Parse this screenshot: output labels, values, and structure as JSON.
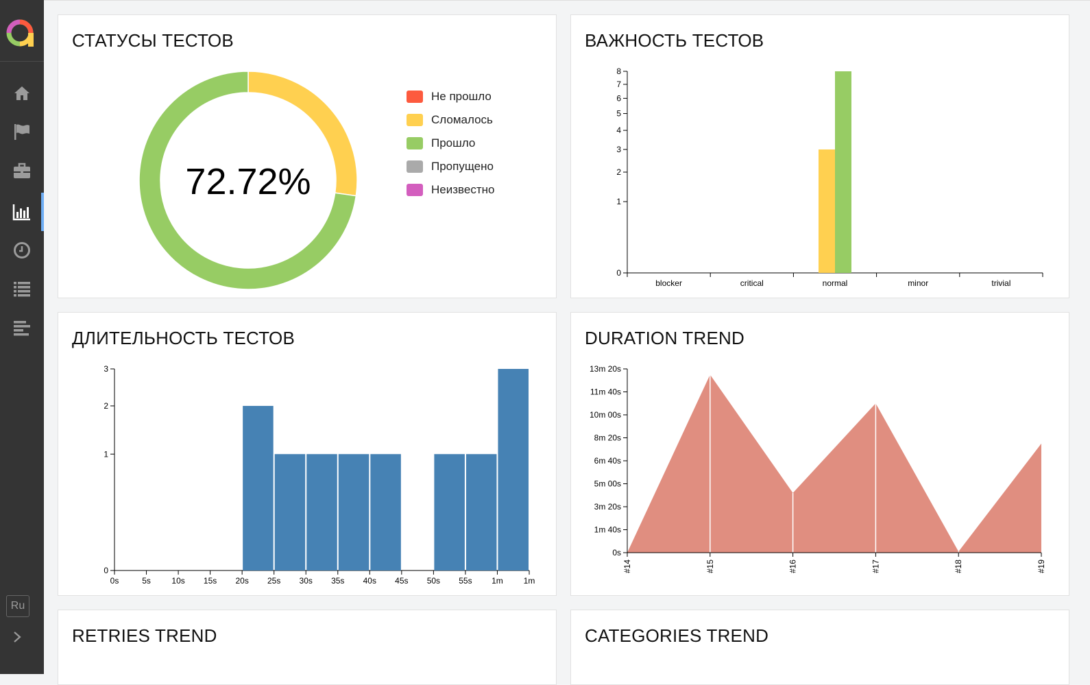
{
  "nav": {
    "items": [
      {
        "icon": "home-icon"
      },
      {
        "icon": "flag-icon"
      },
      {
        "icon": "briefcase-icon"
      },
      {
        "icon": "bar-chart-icon",
        "active": true
      },
      {
        "icon": "clock-icon"
      },
      {
        "icon": "list-icon"
      },
      {
        "icon": "timeline-icon"
      }
    ],
    "language": "Ru"
  },
  "colors": {
    "failed": "#fd5a3e",
    "broken": "#ffd050",
    "passed": "#97cc64",
    "skipped": "#aaaaaa",
    "unknown": "#d35ebe",
    "duration_bar": "#4682b4",
    "trend_area": "#e08e80"
  },
  "widgets": {
    "statuses": {
      "title": "СТАТУСЫ ТЕСТОВ",
      "percent_label": "72.72%",
      "legend": [
        {
          "label": "Не прошло",
          "color": "#fd5a3e"
        },
        {
          "label": "Сломалось",
          "color": "#ffd050"
        },
        {
          "label": "Прошло",
          "color": "#97cc64"
        },
        {
          "label": "Пропущено",
          "color": "#aaaaaa"
        },
        {
          "label": "Неизвестно",
          "color": "#d35ebe"
        }
      ]
    },
    "severity": {
      "title": "ВАЖНОСТЬ ТЕСТОВ"
    },
    "duration": {
      "title": "ДЛИТЕЛЬНОСТЬ ТЕСТОВ"
    },
    "duration_trend": {
      "title": "DURATION TREND"
    },
    "retries_trend": {
      "title": "RETRIES TREND"
    },
    "categories_trend": {
      "title": "CATEGORIES TREND"
    }
  },
  "chart_data": [
    {
      "type": "pie",
      "title": "СТАТУСЫ ТЕСТОВ",
      "slices": [
        {
          "name": "Сломалось",
          "value": 3,
          "color": "#ffd050"
        },
        {
          "name": "Прошло",
          "value": 8,
          "color": "#97cc64"
        }
      ],
      "center_label": "72.72%"
    },
    {
      "type": "bar",
      "title": "ВАЖНОСТЬ ТЕСТОВ",
      "categories": [
        "blocker",
        "critical",
        "normal",
        "minor",
        "trivial"
      ],
      "series": [
        {
          "color": "#ffd050",
          "values": [
            0,
            0,
            3,
            0,
            0
          ]
        },
        {
          "color": "#97cc64",
          "values": [
            0,
            0,
            8,
            0,
            0
          ]
        }
      ],
      "yticks": [
        0,
        1,
        2,
        3,
        4,
        5,
        6,
        7,
        8
      ],
      "yscale": "sqrt",
      "ylim": [
        0,
        8
      ]
    },
    {
      "type": "bar",
      "title": "ДЛИТЕЛЬНОСТЬ ТЕСТОВ",
      "xticks": [
        "0s",
        "5s",
        "10s",
        "15s",
        "20s",
        "25s",
        "30s",
        "35s",
        "40s",
        "45s",
        "50s",
        "55s",
        "1m",
        "1m"
      ],
      "bins": [
        0,
        0,
        0,
        0,
        2,
        1,
        1,
        1,
        1,
        0,
        1,
        1,
        3
      ],
      "yticks": [
        0,
        1,
        2,
        3
      ],
      "yscale": "sqrt",
      "ylim": [
        0,
        3
      ],
      "color": "#4682b4"
    },
    {
      "type": "area",
      "title": "DURATION TREND",
      "x": [
        "#14",
        "#15",
        "#16",
        "#17",
        "#18",
        "#19"
      ],
      "values_seconds": [
        0,
        775,
        260,
        650,
        5,
        475
      ],
      "yticks": [
        "0s",
        "1m 40s",
        "3m 20s",
        "5m 00s",
        "6m 40s",
        "8m 20s",
        "10m 00s",
        "11m 40s",
        "13m 20s"
      ],
      "ylim_seconds": [
        0,
        800
      ],
      "color": "#e08e80"
    }
  ]
}
